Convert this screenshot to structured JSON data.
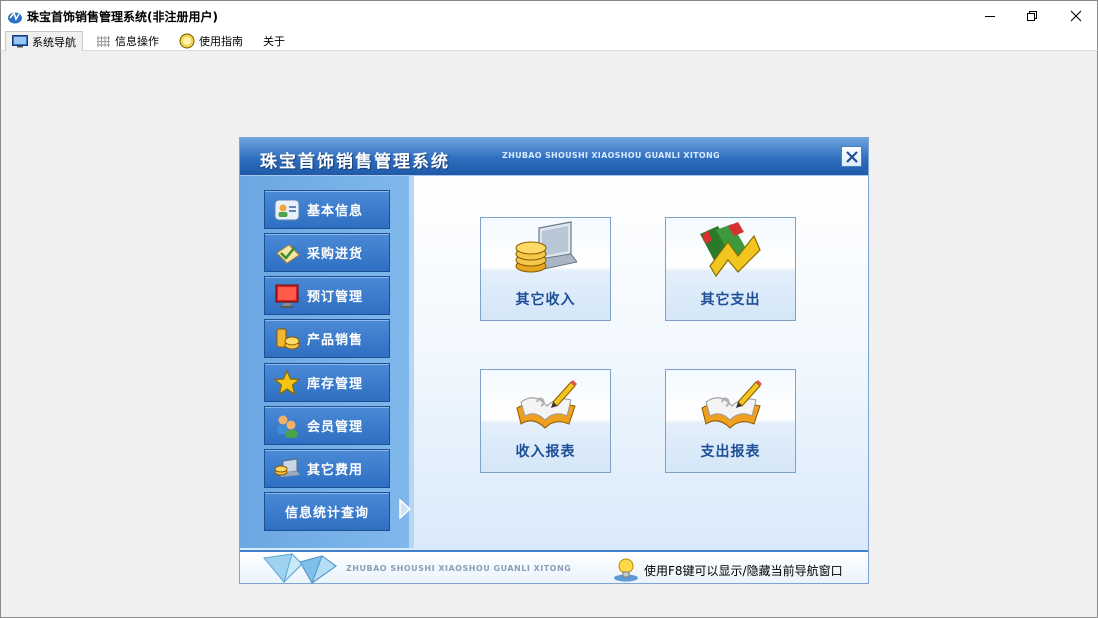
{
  "window": {
    "title": "珠宝首饰销售管理系统(非注册用户)",
    "icon": "app-logo-icon"
  },
  "menu": {
    "items": [
      {
        "label": "系统导航",
        "icon": "monitor-icon"
      },
      {
        "label": "信息操作",
        "icon": "grid-icon"
      },
      {
        "label": "使用指南",
        "icon": "help-bulb-icon"
      },
      {
        "label": "关于",
        "icon": ""
      }
    ]
  },
  "nav": {
    "title": "珠宝首饰销售管理系统",
    "subtitle": "ZHUBAO SHOUSHI XIAOSHOU GUANLI XITONG",
    "sidebar": [
      {
        "label": "基本信息",
        "icon": "contacts-icon"
      },
      {
        "label": "采购进货",
        "icon": "purchase-icon"
      },
      {
        "label": "预订管理",
        "icon": "monitor-icon"
      },
      {
        "label": "产品销售",
        "icon": "coins-icon"
      },
      {
        "label": "库存管理",
        "icon": "star-icon"
      },
      {
        "label": "会员管理",
        "icon": "members-icon"
      },
      {
        "label": "其它费用",
        "icon": "laptop-coins-icon"
      },
      {
        "label": "信息统计查询",
        "icon": ""
      }
    ],
    "tiles": [
      {
        "label": "其它收入",
        "icon": "coins-laptop-icon"
      },
      {
        "label": "其它支出",
        "icon": "chart-arrow-icon"
      },
      {
        "label": "收入报表",
        "icon": "report-book-icon"
      },
      {
        "label": "支出报表",
        "icon": "report-book-icon"
      }
    ],
    "footer": {
      "subtitle": "ZHUBAO SHOUSHI XIAOSHOU GUANLI XITONG",
      "hint": "使用F8键可以显示/隐藏当前导航窗口"
    }
  },
  "colors": {
    "header_blue": "#2e6fbf",
    "sidebar_blue": "#6ba7e3",
    "button_blue": "#2f6fc2",
    "tile_text": "#1d4e96"
  }
}
